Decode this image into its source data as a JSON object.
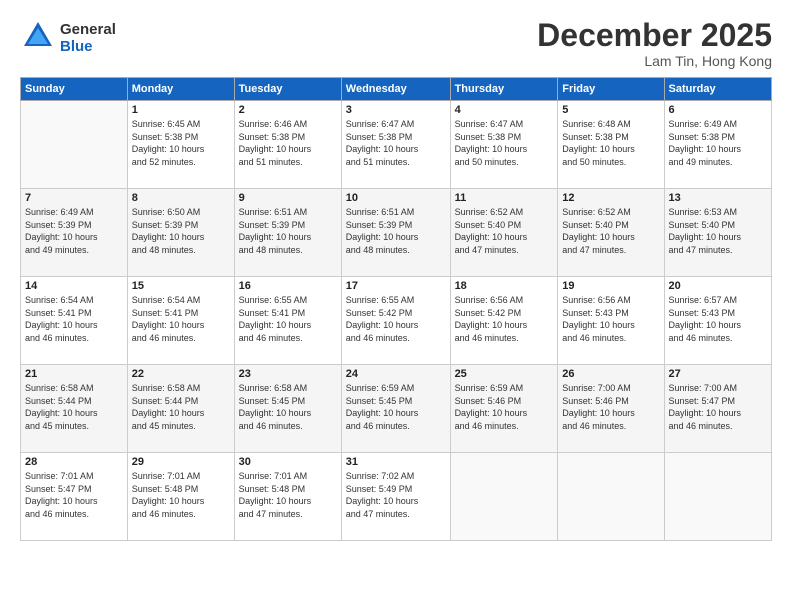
{
  "logo": {
    "general": "General",
    "blue": "Blue"
  },
  "title": "December 2025",
  "location": "Lam Tin, Hong Kong",
  "days_of_week": [
    "Sunday",
    "Monday",
    "Tuesday",
    "Wednesday",
    "Thursday",
    "Friday",
    "Saturday"
  ],
  "weeks": [
    [
      {
        "day": "",
        "info": ""
      },
      {
        "day": "1",
        "info": "Sunrise: 6:45 AM\nSunset: 5:38 PM\nDaylight: 10 hours\nand 52 minutes."
      },
      {
        "day": "2",
        "info": "Sunrise: 6:46 AM\nSunset: 5:38 PM\nDaylight: 10 hours\nand 51 minutes."
      },
      {
        "day": "3",
        "info": "Sunrise: 6:47 AM\nSunset: 5:38 PM\nDaylight: 10 hours\nand 51 minutes."
      },
      {
        "day": "4",
        "info": "Sunrise: 6:47 AM\nSunset: 5:38 PM\nDaylight: 10 hours\nand 50 minutes."
      },
      {
        "day": "5",
        "info": "Sunrise: 6:48 AM\nSunset: 5:38 PM\nDaylight: 10 hours\nand 50 minutes."
      },
      {
        "day": "6",
        "info": "Sunrise: 6:49 AM\nSunset: 5:38 PM\nDaylight: 10 hours\nand 49 minutes."
      }
    ],
    [
      {
        "day": "7",
        "info": "Sunrise: 6:49 AM\nSunset: 5:39 PM\nDaylight: 10 hours\nand 49 minutes."
      },
      {
        "day": "8",
        "info": "Sunrise: 6:50 AM\nSunset: 5:39 PM\nDaylight: 10 hours\nand 48 minutes."
      },
      {
        "day": "9",
        "info": "Sunrise: 6:51 AM\nSunset: 5:39 PM\nDaylight: 10 hours\nand 48 minutes."
      },
      {
        "day": "10",
        "info": "Sunrise: 6:51 AM\nSunset: 5:39 PM\nDaylight: 10 hours\nand 48 minutes."
      },
      {
        "day": "11",
        "info": "Sunrise: 6:52 AM\nSunset: 5:40 PM\nDaylight: 10 hours\nand 47 minutes."
      },
      {
        "day": "12",
        "info": "Sunrise: 6:52 AM\nSunset: 5:40 PM\nDaylight: 10 hours\nand 47 minutes."
      },
      {
        "day": "13",
        "info": "Sunrise: 6:53 AM\nSunset: 5:40 PM\nDaylight: 10 hours\nand 47 minutes."
      }
    ],
    [
      {
        "day": "14",
        "info": "Sunrise: 6:54 AM\nSunset: 5:41 PM\nDaylight: 10 hours\nand 46 minutes."
      },
      {
        "day": "15",
        "info": "Sunrise: 6:54 AM\nSunset: 5:41 PM\nDaylight: 10 hours\nand 46 minutes."
      },
      {
        "day": "16",
        "info": "Sunrise: 6:55 AM\nSunset: 5:41 PM\nDaylight: 10 hours\nand 46 minutes."
      },
      {
        "day": "17",
        "info": "Sunrise: 6:55 AM\nSunset: 5:42 PM\nDaylight: 10 hours\nand 46 minutes."
      },
      {
        "day": "18",
        "info": "Sunrise: 6:56 AM\nSunset: 5:42 PM\nDaylight: 10 hours\nand 46 minutes."
      },
      {
        "day": "19",
        "info": "Sunrise: 6:56 AM\nSunset: 5:43 PM\nDaylight: 10 hours\nand 46 minutes."
      },
      {
        "day": "20",
        "info": "Sunrise: 6:57 AM\nSunset: 5:43 PM\nDaylight: 10 hours\nand 46 minutes."
      }
    ],
    [
      {
        "day": "21",
        "info": "Sunrise: 6:58 AM\nSunset: 5:44 PM\nDaylight: 10 hours\nand 45 minutes."
      },
      {
        "day": "22",
        "info": "Sunrise: 6:58 AM\nSunset: 5:44 PM\nDaylight: 10 hours\nand 45 minutes."
      },
      {
        "day": "23",
        "info": "Sunrise: 6:58 AM\nSunset: 5:45 PM\nDaylight: 10 hours\nand 46 minutes."
      },
      {
        "day": "24",
        "info": "Sunrise: 6:59 AM\nSunset: 5:45 PM\nDaylight: 10 hours\nand 46 minutes."
      },
      {
        "day": "25",
        "info": "Sunrise: 6:59 AM\nSunset: 5:46 PM\nDaylight: 10 hours\nand 46 minutes."
      },
      {
        "day": "26",
        "info": "Sunrise: 7:00 AM\nSunset: 5:46 PM\nDaylight: 10 hours\nand 46 minutes."
      },
      {
        "day": "27",
        "info": "Sunrise: 7:00 AM\nSunset: 5:47 PM\nDaylight: 10 hours\nand 46 minutes."
      }
    ],
    [
      {
        "day": "28",
        "info": "Sunrise: 7:01 AM\nSunset: 5:47 PM\nDaylight: 10 hours\nand 46 minutes."
      },
      {
        "day": "29",
        "info": "Sunrise: 7:01 AM\nSunset: 5:48 PM\nDaylight: 10 hours\nand 46 minutes."
      },
      {
        "day": "30",
        "info": "Sunrise: 7:01 AM\nSunset: 5:48 PM\nDaylight: 10 hours\nand 47 minutes."
      },
      {
        "day": "31",
        "info": "Sunrise: 7:02 AM\nSunset: 5:49 PM\nDaylight: 10 hours\nand 47 minutes."
      },
      {
        "day": "",
        "info": ""
      },
      {
        "day": "",
        "info": ""
      },
      {
        "day": "",
        "info": ""
      }
    ]
  ]
}
